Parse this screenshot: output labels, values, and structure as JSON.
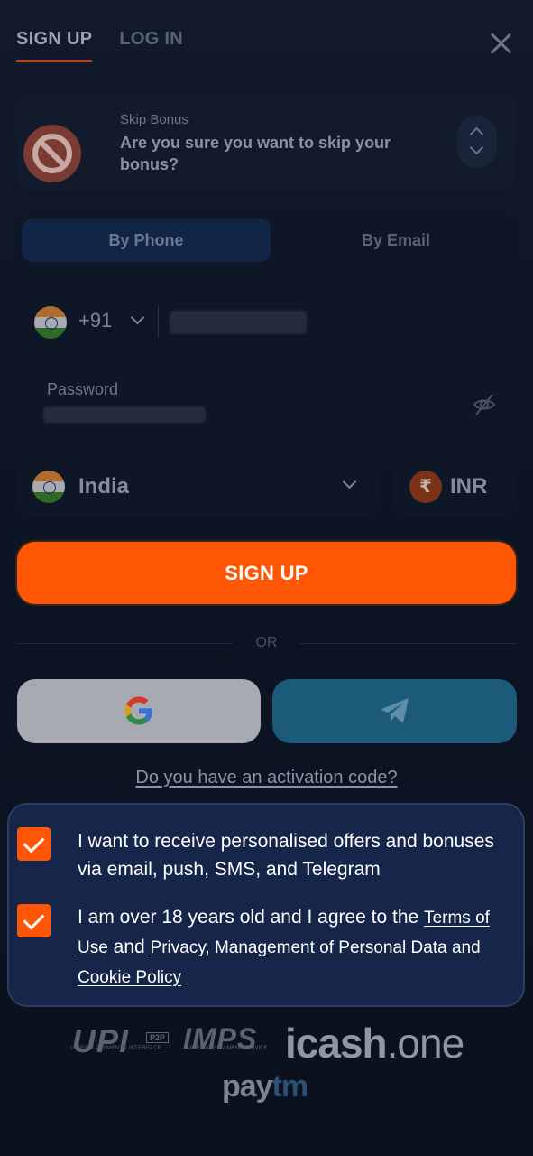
{
  "header": {
    "tabs": [
      {
        "label": "SIGN UP",
        "active": true
      },
      {
        "label": "LOG IN",
        "active": false
      }
    ]
  },
  "bonus": {
    "subtitle": "Skip Bonus",
    "text": "Are you sure you want to skip your bonus?"
  },
  "method": {
    "options": [
      "By Phone",
      "By Email"
    ],
    "selected": "By Phone"
  },
  "phone": {
    "country_code": "+91",
    "flag": "india-flag-icon"
  },
  "password": {
    "label": "Password"
  },
  "country": {
    "name": "India",
    "currency_symbol": "₹",
    "currency": "INR"
  },
  "actions": {
    "signup_label": "SIGN UP",
    "or_label": "OR",
    "activation_link": "Do you have an activation code?"
  },
  "consent": {
    "offers_text": "I want to receive personalised offers and bonuses via email, push, SMS, and Telegram",
    "age_prefix": "I am over 18 years old and I agree to the",
    "terms_link": "Terms of Use",
    "and_text": "and",
    "privacy_link": "Privacy, Management of Personal Data and Cookie Policy"
  },
  "payments": {
    "upi": "UPI",
    "upi_sub": "UNIFIED PAYMENTS INTERFACE",
    "upi_tag": "P2P",
    "imps": "IMPS",
    "imps_sub": "IMMEDIATE PAYMENT SERVICE",
    "icash_main": "icash",
    "icash_dot": ".one",
    "paytm_pay": "pay",
    "paytm_tm": "tm"
  },
  "colors": {
    "accent": "#ff5606",
    "background": "#0c1322",
    "consent_bg": "#15264a",
    "telegram": "#1b5a78"
  }
}
